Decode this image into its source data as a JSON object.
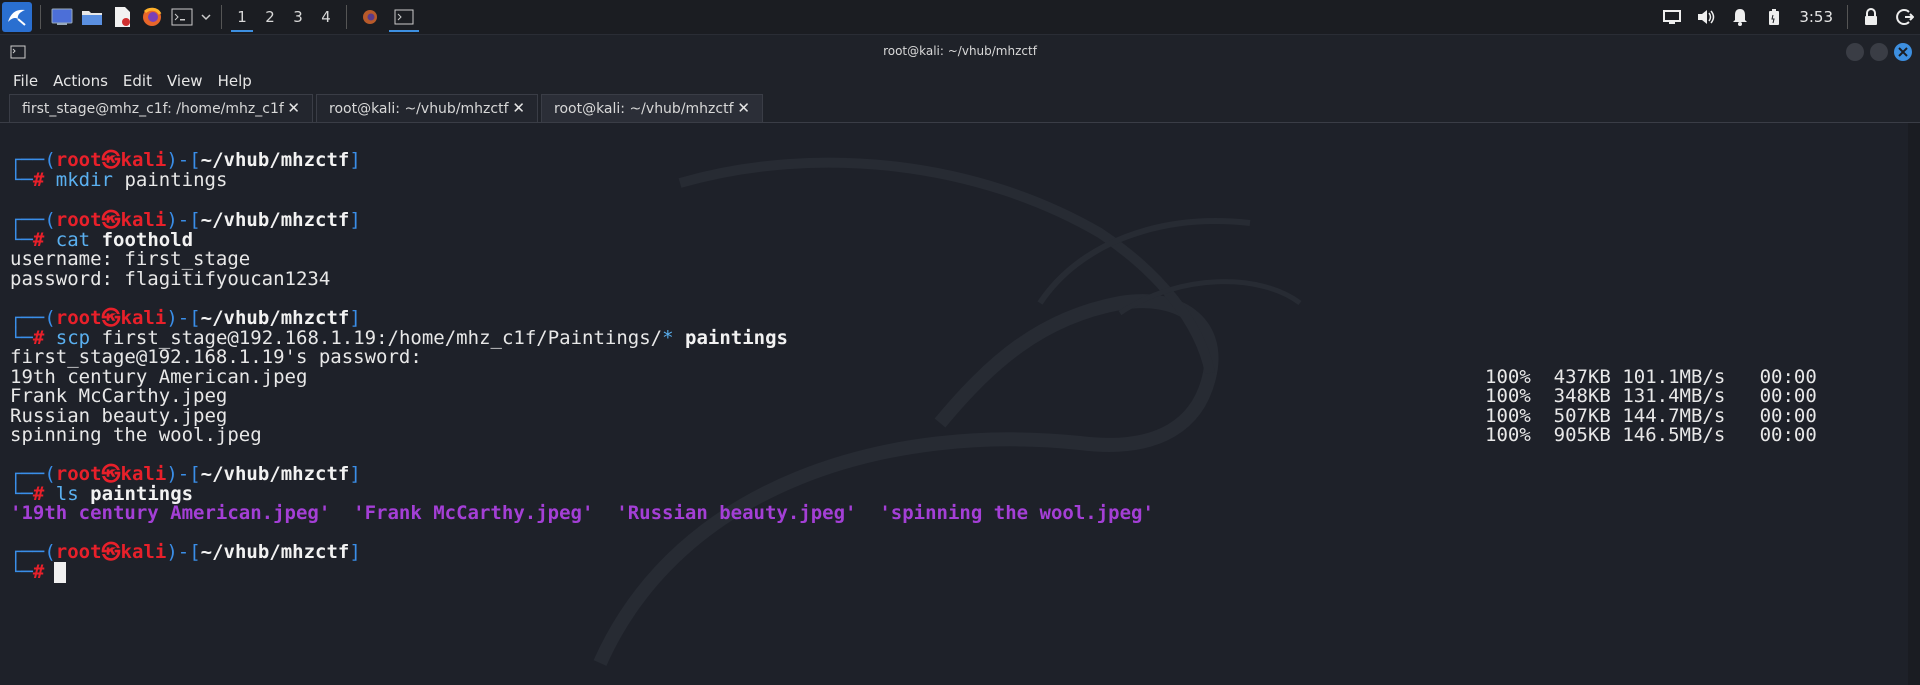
{
  "taskbar": {
    "workspaces": [
      "1",
      "2",
      "3",
      "4"
    ],
    "active_workspace": "1",
    "clock": "3:53"
  },
  "window": {
    "title": "root@kali: ~/vhub/mhzctf"
  },
  "menu": [
    "File",
    "Actions",
    "Edit",
    "View",
    "Help"
  ],
  "tabs": [
    {
      "label": "first_stage@mhz_c1f: /home/mhz_c1f",
      "close": "✕"
    },
    {
      "label": "root@kali: ~/vhub/mhzctf",
      "close": "✕"
    },
    {
      "label": "root@kali: ~/vhub/mhzctf",
      "close": "✕",
      "active": true
    }
  ],
  "prompt": {
    "user": "root",
    "host": "kali",
    "path": "~/vhub/mhzctf",
    "symbol": "#"
  },
  "session": {
    "cmd1": {
      "command": "mkdir",
      "args": "paintings"
    },
    "cmd2": {
      "command": "cat",
      "args": "foothold"
    },
    "cat_output": [
      "username: first_stage",
      "password: flagitifyoucan1234"
    ],
    "cmd3": {
      "command": "scp",
      "args": "first_stage@192.168.1.19:/home/mhz_c1f/Paintings/",
      "glob": "*",
      "target": "paintings"
    },
    "scp_password_prompt": "first_stage@192.168.1.19's password:",
    "transfers": [
      {
        "file": "19th century American.jpeg",
        "percent": "100%",
        "size": "437KB",
        "speed": "101.1MB/s",
        "time": "00:00"
      },
      {
        "file": "Frank McCarthy.jpeg",
        "percent": "100%",
        "size": "348KB",
        "speed": "131.4MB/s",
        "time": "00:00"
      },
      {
        "file": "Russian beauty.jpeg",
        "percent": "100%",
        "size": "507KB",
        "speed": "144.7MB/s",
        "time": "00:00"
      },
      {
        "file": "spinning the wool.jpeg",
        "percent": "100%",
        "size": "905KB",
        "speed": "146.5MB/s",
        "time": "00:00"
      }
    ],
    "cmd4": {
      "command": "ls",
      "args": "paintings"
    },
    "ls_output": "'19th century American.jpeg'  'Frank McCarthy.jpeg'  'Russian beauty.jpeg'  'spinning the wool.jpeg'"
  },
  "colors": {
    "prompt_frame": "#3a8ee8",
    "prompt_user_host": "#e8202a",
    "command": "#5ab0f0",
    "ls_files": "#a43fd6",
    "background": "#1e2129"
  }
}
